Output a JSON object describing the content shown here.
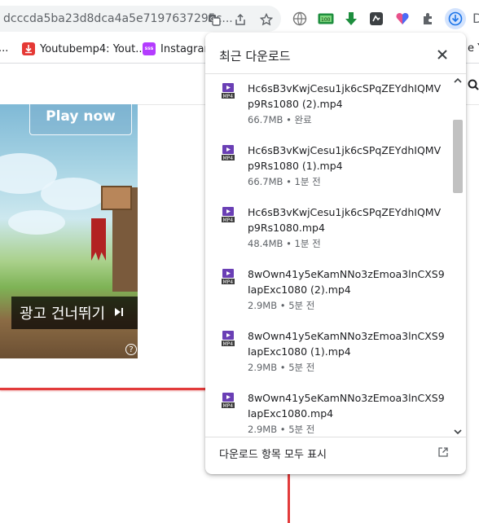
{
  "browser": {
    "url": "dcccda5ba23d8dca4a5e7197637295c...",
    "bookmarks": [
      {
        "label": "...",
        "color": "#666666"
      },
      {
        "label": "Youtubemp4: Yout...",
        "color": "#e53935"
      },
      {
        "label": "Instagram",
        "color": "#b43cff"
      }
    ],
    "right_edge_text": "e Y",
    "toolbar_right_char": "D"
  },
  "ad": {
    "play_label": "Play now",
    "skip_label": "광고 건너뛰기",
    "skip_icon": "skip-next-icon",
    "info_icon": "info-icon"
  },
  "downloads": {
    "title": "최근 다운로드",
    "footer_label": "다운로드 항목 모두 표시",
    "items": [
      {
        "name": "Hc6sB3vKwjCesu1jk6cSPqZEYdhIQMVp9Rs1080 (2).mp4",
        "meta": "66.7MB • 완료"
      },
      {
        "name": "Hc6sB3vKwjCesu1jk6cSPqZEYdhIQMVp9Rs1080 (1).mp4",
        "meta": "66.7MB • 1분 전"
      },
      {
        "name": "Hc6sB3vKwjCesu1jk6cSPqZEYdhIQMVp9Rs1080.mp4",
        "meta": "48.4MB • 1분 전"
      },
      {
        "name": "8wOwn41y5eKamNNo3zEmoa3lnCXS9IapExc1080 (2).mp4",
        "meta": "2.9MB • 5분 전"
      },
      {
        "name": "8wOwn41y5eKamNNo3zEmoa3lnCXS9IapExc1080 (1).mp4",
        "meta": "2.9MB • 5분 전"
      },
      {
        "name": "8wOwn41y5eKamNNo3zEmoa3lnCXS9IapExc1080.mp4",
        "meta": "2.9MB • 5분 전"
      }
    ]
  },
  "colors": {
    "accent": "#1a73e8",
    "red_line": "#e23b3b",
    "file_icon": "#6a3fb5"
  }
}
